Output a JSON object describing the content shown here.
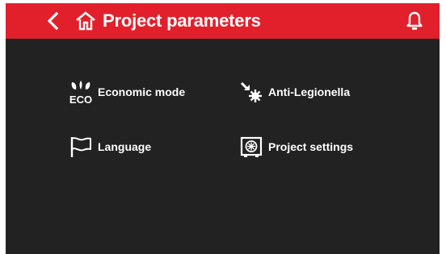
{
  "header": {
    "title": "Project parameters",
    "back_icon": "chevron-left-icon",
    "home_icon": "home-icon",
    "notification_icon": "bell-icon",
    "accent_color": "#e2202c"
  },
  "menu": {
    "items": [
      {
        "label": "Economic mode",
        "icon": "eco-icon"
      },
      {
        "label": "Anti-Legionella",
        "icon": "anti-legionella-icon"
      },
      {
        "label": "Language",
        "icon": "flag-icon"
      },
      {
        "label": "Project settings",
        "icon": "project-settings-icon"
      }
    ]
  },
  "eco_icon_text": "ECO"
}
